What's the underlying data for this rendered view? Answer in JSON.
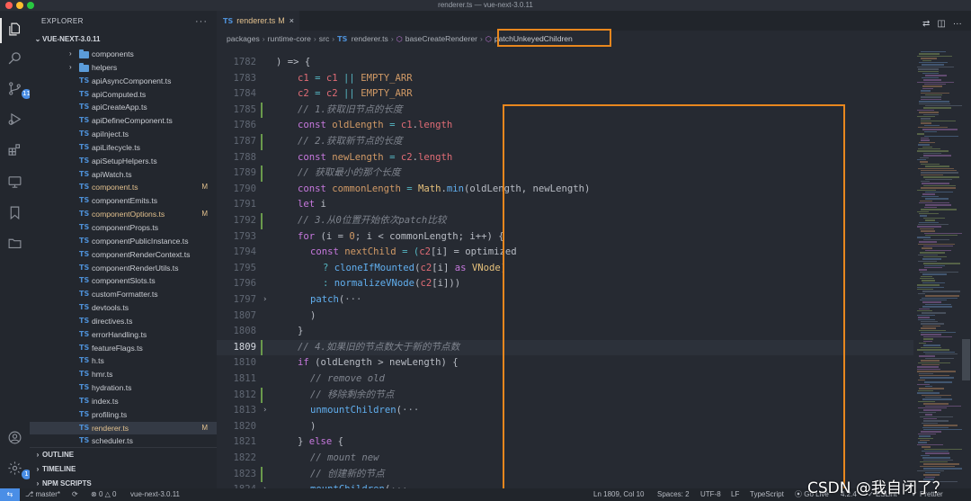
{
  "window": {
    "title": "renderer.ts — vue-next-3.0.11"
  },
  "activity_bar": {
    "items": [
      {
        "icon": "files-icon"
      },
      {
        "icon": "search-icon"
      },
      {
        "icon": "source-control-icon",
        "badge": "11"
      },
      {
        "icon": "run-debug-icon"
      },
      {
        "icon": "extensions-icon"
      },
      {
        "icon": "remote-explorer-icon"
      },
      {
        "icon": "bookmark-icon"
      },
      {
        "icon": "folder-icon"
      }
    ],
    "bottom": [
      {
        "icon": "account-icon"
      },
      {
        "icon": "settings-gear-icon",
        "badge": "1"
      }
    ]
  },
  "sidebar": {
    "title": "EXPLORER",
    "more": "···",
    "root": "VUE-NEXT-3.0.11",
    "folders": [
      "components",
      "helpers"
    ],
    "files": [
      {
        "name": "apiAsyncComponent.ts",
        "type": "TS",
        "modified": false
      },
      {
        "name": "apiComputed.ts",
        "type": "TS",
        "modified": false
      },
      {
        "name": "apiCreateApp.ts",
        "type": "TS",
        "modified": false
      },
      {
        "name": "apiDefineComponent.ts",
        "type": "TS",
        "modified": false
      },
      {
        "name": "apiInject.ts",
        "type": "TS",
        "modified": false
      },
      {
        "name": "apiLifecycle.ts",
        "type": "TS",
        "modified": false
      },
      {
        "name": "apiSetupHelpers.ts",
        "type": "TS",
        "modified": false
      },
      {
        "name": "apiWatch.ts",
        "type": "TS",
        "modified": false
      },
      {
        "name": "component.ts",
        "type": "TS",
        "modified": true,
        "flag": "M"
      },
      {
        "name": "componentEmits.ts",
        "type": "TS",
        "modified": false
      },
      {
        "name": "componentOptions.ts",
        "type": "TS",
        "modified": true,
        "flag": "M"
      },
      {
        "name": "componentProps.ts",
        "type": "TS",
        "modified": false
      },
      {
        "name": "componentPublicInstance.ts",
        "type": "TS",
        "modified": false
      },
      {
        "name": "componentRenderContext.ts",
        "type": "TS",
        "modified": false
      },
      {
        "name": "componentRenderUtils.ts",
        "type": "TS",
        "modified": false
      },
      {
        "name": "componentSlots.ts",
        "type": "TS",
        "modified": false
      },
      {
        "name": "customFormatter.ts",
        "type": "TS",
        "modified": false
      },
      {
        "name": "devtools.ts",
        "type": "TS",
        "modified": false
      },
      {
        "name": "directives.ts",
        "type": "TS",
        "modified": false
      },
      {
        "name": "errorHandling.ts",
        "type": "TS",
        "modified": false
      },
      {
        "name": "featureFlags.ts",
        "type": "TS",
        "modified": false
      },
      {
        "name": "h.ts",
        "type": "TS",
        "modified": false
      },
      {
        "name": "hmr.ts",
        "type": "TS",
        "modified": false
      },
      {
        "name": "hydration.ts",
        "type": "TS",
        "modified": false
      },
      {
        "name": "index.ts",
        "type": "TS",
        "modified": false
      },
      {
        "name": "profiling.ts",
        "type": "TS",
        "modified": false
      },
      {
        "name": "renderer.ts",
        "type": "TS",
        "modified": true,
        "flag": "M",
        "selected": true
      },
      {
        "name": "scheduler.ts",
        "type": "TS",
        "modified": false
      }
    ],
    "sections": [
      "OUTLINE",
      "TIMELINE",
      "NPM SCRIPTS"
    ]
  },
  "tab": {
    "type": "TS",
    "label": "renderer.ts",
    "flag": "M",
    "close": "×"
  },
  "tab_actions": [
    "compare-icon",
    "split-editor-icon",
    "more-icon"
  ],
  "breadcrumb": {
    "items": [
      "packages",
      "runtime-core",
      "src",
      "renderer.ts",
      "baseCreateRenderer",
      "patchUnkeyedChildren"
    ],
    "file_type": "TS"
  },
  "code": {
    "current_line": "1809",
    "lines": [
      {
        "n": "1782",
        "gutter": "",
        "fold": false
      },
      {
        "n": "1783",
        "gutter": "",
        "fold": false
      },
      {
        "n": "1784",
        "gutter": "",
        "fold": false
      },
      {
        "n": "1785",
        "gutter": "add",
        "fold": false
      },
      {
        "n": "1786",
        "gutter": "",
        "fold": false
      },
      {
        "n": "1787",
        "gutter": "add",
        "fold": false
      },
      {
        "n": "1788",
        "gutter": "",
        "fold": false
      },
      {
        "n": "1789",
        "gutter": "add",
        "fold": false
      },
      {
        "n": "1790",
        "gutter": "",
        "fold": false
      },
      {
        "n": "1791",
        "gutter": "",
        "fold": false
      },
      {
        "n": "1792",
        "gutter": "add",
        "fold": false
      },
      {
        "n": "1793",
        "gutter": "",
        "fold": false
      },
      {
        "n": "1794",
        "gutter": "",
        "fold": false
      },
      {
        "n": "1795",
        "gutter": "",
        "fold": false
      },
      {
        "n": "1796",
        "gutter": "",
        "fold": false
      },
      {
        "n": "1797",
        "gutter": "",
        "fold": true
      },
      {
        "n": "1807",
        "gutter": "",
        "fold": false
      },
      {
        "n": "1808",
        "gutter": "",
        "fold": false
      },
      {
        "n": "1809",
        "gutter": "add",
        "fold": false
      },
      {
        "n": "1810",
        "gutter": "",
        "fold": false
      },
      {
        "n": "1811",
        "gutter": "",
        "fold": false
      },
      {
        "n": "1812",
        "gutter": "add",
        "fold": false
      },
      {
        "n": "1813",
        "gutter": "",
        "fold": true
      },
      {
        "n": "1820",
        "gutter": "",
        "fold": false
      },
      {
        "n": "1821",
        "gutter": "",
        "fold": false
      },
      {
        "n": "1822",
        "gutter": "",
        "fold": false
      },
      {
        "n": "1823",
        "gutter": "add",
        "fold": false
      },
      {
        "n": "1824",
        "gutter": "",
        "fold": true
      }
    ],
    "text": {
      "l1782": ") => {",
      "l1783_a": "c1",
      "l1783_b": " = ",
      "l1783_c": "c1",
      "l1783_d": " || ",
      "l1783_e": "EMPTY_ARR",
      "l1784_a": "c2",
      "l1784_b": " = ",
      "l1784_c": "c2",
      "l1784_d": " || ",
      "l1784_e": "EMPTY_ARR",
      "l1785": "// 1.获取旧节点的长度",
      "l1786_a": "const ",
      "l1786_b": "oldLength",
      "l1786_c": " = ",
      "l1786_d": "c1",
      "l1786_e": ".",
      "l1786_f": "length",
      "l1787": "// 2.获取新节点的长度",
      "l1788_a": "const ",
      "l1788_b": "newLength",
      "l1788_c": " = ",
      "l1788_d": "c2",
      "l1788_e": ".",
      "l1788_f": "length",
      "l1789": "// 获取最小的那个长度",
      "l1790_a": "const ",
      "l1790_b": "commonLength",
      "l1790_c": " = ",
      "l1790_d": "Math",
      "l1790_e": ".",
      "l1790_f": "min",
      "l1790_g": "(oldLength, newLength)",
      "l1791_a": "let ",
      "l1791_b": "i",
      "l1792": "// 3.从0位置开始依次patch比较",
      "l1793_a": "for",
      "l1793_b": " (i = ",
      "l1793_c": "0",
      "l1793_d": "; i < commonLength; i++) {",
      "l1794_a": "const ",
      "l1794_b": "nextChild",
      "l1794_c": " = (",
      "l1794_d": "c2",
      "l1794_e": "[i] = optimized",
      "l1795_a": "? ",
      "l1795_b": "cloneIfMounted",
      "l1795_c": "(",
      "l1795_d": "c2",
      "l1795_e": "[i] ",
      "l1795_f": "as",
      "l1795_g": " VNode",
      "l1795_h": ")",
      "l1796_a": ": ",
      "l1796_b": "normalizeVNode",
      "l1796_c": "(",
      "l1796_d": "c2",
      "l1796_e": "[i]))",
      "l1797_a": "patch",
      "l1797_b": "(",
      "l1797_c": "···",
      "l1807": ")",
      "l1808": "}",
      "l1809": "// 4.如果旧的节点数大于新的节点数",
      "l1810_a": "if",
      "l1810_b": " (oldLength > newLength) {",
      "l1811": "// remove old",
      "l1812": "// 移除剩余的节点",
      "l1813_a": "unmountChildren",
      "l1813_b": "(",
      "l1813_c": "···",
      "l1820": ")",
      "l1821_a": "} ",
      "l1821_b": "else",
      "l1821_c": " {",
      "l1822": "// mount new",
      "l1823": "// 创建新的节点",
      "l1824_a": "mountChildren",
      "l1824_b": "(",
      "l1824_c": "···"
    }
  },
  "statusbar": {
    "branch": "master*",
    "sync": "⟳",
    "errors": "0",
    "warnings": "0",
    "folder": "vue-next-3.0.11",
    "position": "Ln 1809, Col 10",
    "spaces": "Spaces: 2",
    "encoding": "UTF-8",
    "eol": "LF",
    "language": "TypeScript",
    "golive": "Go Live",
    "version": "4.2.4",
    "eslint": "ESLint",
    "prettier": "Prettier"
  },
  "watermark": "CSDN @我自闭了？",
  "colors": {
    "accent_highlight": "#e8871e",
    "ts_icon": "#4d8fd6",
    "modified": "#e2c08d",
    "status_remote": "#4a8ee6"
  }
}
